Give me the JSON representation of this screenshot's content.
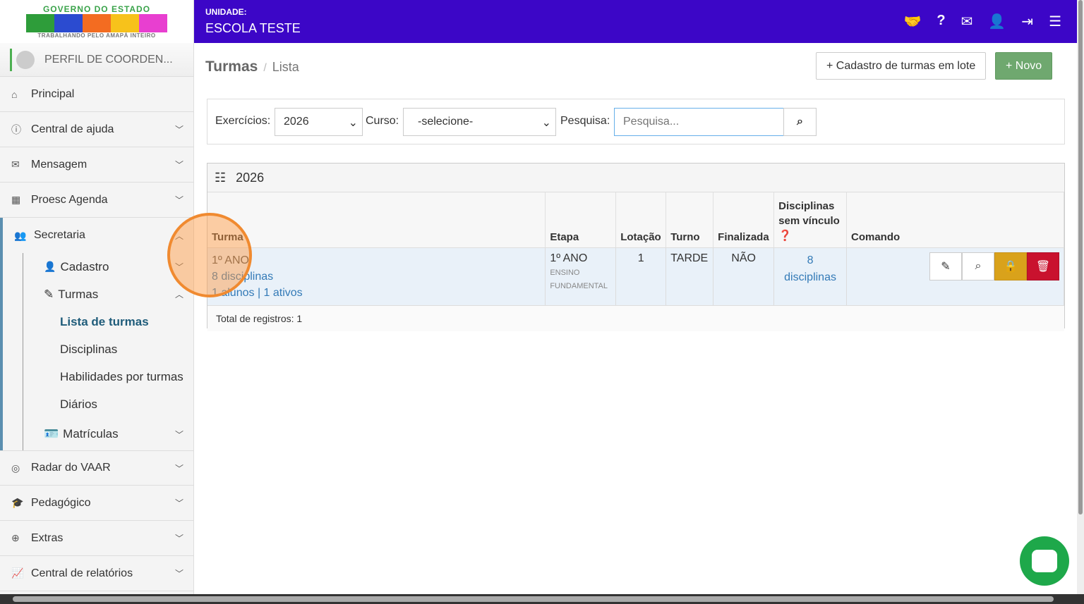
{
  "logo": {
    "line1": "GOVERNO DO ESTADO",
    "line2": "AMAPÁ",
    "line3": "TRABALHANDO PELO AMAPÁ INTEIRO"
  },
  "header": {
    "unit_label": "UNIDADE:",
    "unit_name": "ESCOLA TESTE",
    "icons": [
      "handshake-icon",
      "help-icon",
      "envelope-icon",
      "user-icon",
      "logout-icon",
      "menu-icon"
    ]
  },
  "profile": {
    "name": "PERFIL DE COORDEN..."
  },
  "sidebar": {
    "items": [
      {
        "label": "Principal",
        "icon": "⌂"
      },
      {
        "label": "Central de ajuda",
        "icon": "ⓘ"
      },
      {
        "label": "Mensagem",
        "icon": "✉"
      },
      {
        "label": "Proesc Agenda",
        "icon": "▦"
      }
    ],
    "secretaria": {
      "label": "Secretaria",
      "cadastro": "Cadastro",
      "turmas": "Turmas",
      "lista": "Lista de turmas",
      "disciplinas": "Disciplinas",
      "habilidades": "Habilidades por turmas",
      "diarios": "Diários",
      "matriculas": "Matrículas"
    },
    "items2": [
      {
        "label": "Radar do VAAR",
        "icon": "◎"
      },
      {
        "label": "Pedagógico",
        "icon": "🎓"
      },
      {
        "label": "Extras",
        "icon": "⊕"
      },
      {
        "label": "Central de relatórios",
        "icon": "📈"
      }
    ]
  },
  "breadcrumb": {
    "title": "Turmas",
    "current": "Lista"
  },
  "buttons": {
    "batch": "+ Cadastro de turmas em lote",
    "new": "+ Novo",
    "new_color": "#6fa86f"
  },
  "filters": {
    "exercicios_label": "Exercícios:",
    "exercicios_value": "2026",
    "curso_label": "Curso:",
    "curso_value": "-selecione-",
    "pesquisa_label": "Pesquisa:",
    "pesquisa_placeholder": "Pesquisa..."
  },
  "panel": {
    "title": "2026",
    "columns": [
      "Turma",
      "Etapa",
      "Lotação",
      "Turno",
      "Finalizada",
      "Disciplinas sem vínculo",
      "Comando"
    ],
    "rows": [
      {
        "turma": "1º ANO",
        "disciplinas": "8 disciplinas",
        "alunos": "1 alunos | 1 ativos",
        "etapa": "1º ANO",
        "etapa_sub1": "ENSINO",
        "etapa_sub2": "FUNDAMENTAL",
        "lotacao": "1",
        "turno": "TARDE",
        "finalizada": "NÃO",
        "sem_vinculo": "8 disciplinas"
      }
    ],
    "total": "Total de registros: 1"
  }
}
